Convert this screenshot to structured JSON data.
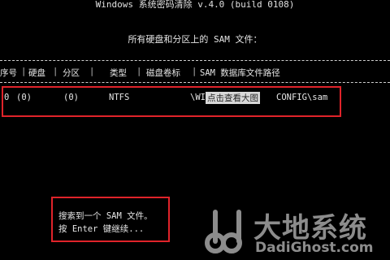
{
  "window": {
    "title": "Windows 系统密码清除 v.4.0 (build 0108)"
  },
  "scan": {
    "heading": "所有硬盘和分区上的 SAM 文件："
  },
  "table": {
    "columns": [
      "序号",
      "硬盘",
      "分区",
      "类型",
      "磁盘卷标",
      "SAM 数据库文件路径"
    ],
    "rows": [
      {
        "index": "0",
        "disk": "(0)",
        "partition": "(0)",
        "type": "NTFS",
        "path_start": "\\WIN",
        "path_overlay": "点击查看大图",
        "path_end": "CONFIG\\sam"
      }
    ]
  },
  "result": {
    "line1": "搜索到一个 SAM 文件。",
    "line2": "按 Enter 键继续..."
  },
  "watermark": {
    "logo_icon": "dadi-logo-icon",
    "cn": "大地系统",
    "en": "DadiGhost.com"
  },
  "colors": {
    "background": "#000000",
    "text": "#e6e6e6",
    "highlight_box": "#e0232a"
  }
}
